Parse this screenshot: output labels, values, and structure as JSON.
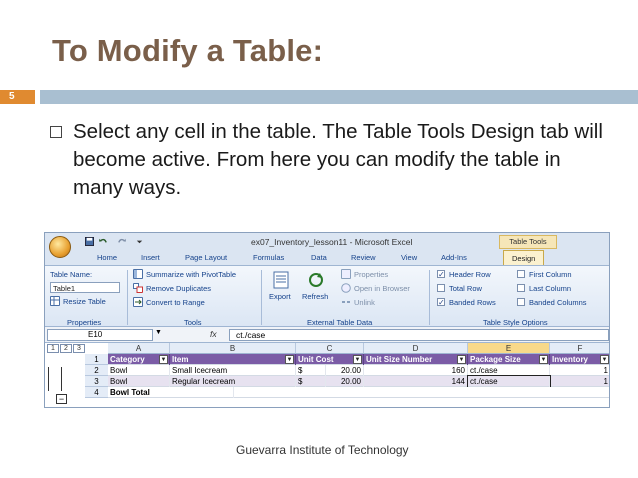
{
  "slide": {
    "title": "To Modify a Table:",
    "number": "5",
    "bullet": "Select any cell in the table. The Table Tools Design tab will become active. From here you can modify the table in many ways.",
    "footer": "Guevarra Institute of Technology"
  },
  "excel": {
    "window_title": "ex07_Inventory_lesson11 - Microsoft Excel",
    "context_tab": "Table Tools",
    "tabs": [
      "Home",
      "Insert",
      "Page Layout",
      "Formulas",
      "Data",
      "Review",
      "View",
      "Add-Ins",
      "Design"
    ],
    "active_tab": "Design",
    "ribbon": {
      "properties": {
        "table_name_label": "Table Name:",
        "table_name_value": "Table1",
        "resize": "Resize Table",
        "label": "Properties"
      },
      "tools": {
        "summarize": "Summarize with PivotTable",
        "remove_duplicates": "Remove Duplicates",
        "convert": "Convert to Range",
        "label": "Tools"
      },
      "external": {
        "export": "Export",
        "refresh": "Refresh",
        "properties": "Properties",
        "open_browser": "Open in Browser",
        "unlink": "Unlink",
        "label": "External Table Data"
      },
      "style_options": {
        "header_row": "Header Row",
        "total_row": "Total Row",
        "banded_rows": "Banded Rows",
        "first_column": "First Column",
        "last_column": "Last Column",
        "banded_columns": "Banded Columns",
        "label": "Table Style Options",
        "checked": {
          "header_row": true,
          "total_row": false,
          "banded_rows": true,
          "first_column": false,
          "last_column": false,
          "banded_columns": false
        }
      }
    },
    "name_box": "E10",
    "fx": "fx",
    "formula": "ct./case",
    "levels": [
      "1",
      "2",
      "3"
    ],
    "columns": [
      "A",
      "B",
      "C",
      "D",
      "E",
      "F"
    ],
    "selected_column": "E",
    "rows": [
      {
        "num": "1",
        "cells": [
          "Category",
          "Item",
          "Unit Cost",
          "",
          "Unit Size Number",
          "Package Size",
          "Inventory"
        ]
      },
      {
        "num": "2",
        "cells": [
          "Bowl",
          "Small Icecream",
          "$",
          "20.00",
          "160",
          "ct./case",
          "1"
        ]
      },
      {
        "num": "3",
        "cells": [
          "Bowl",
          "Regular Icecream",
          "$",
          "20.00",
          "144",
          "ct./case",
          "1"
        ]
      },
      {
        "num": "4",
        "cells": [
          "Bowl Total",
          "",
          "",
          "",
          "",
          "",
          ""
        ]
      }
    ],
    "colors": {
      "header_fill": "#7b5ca6",
      "selected_col": "#f8d98a"
    }
  }
}
